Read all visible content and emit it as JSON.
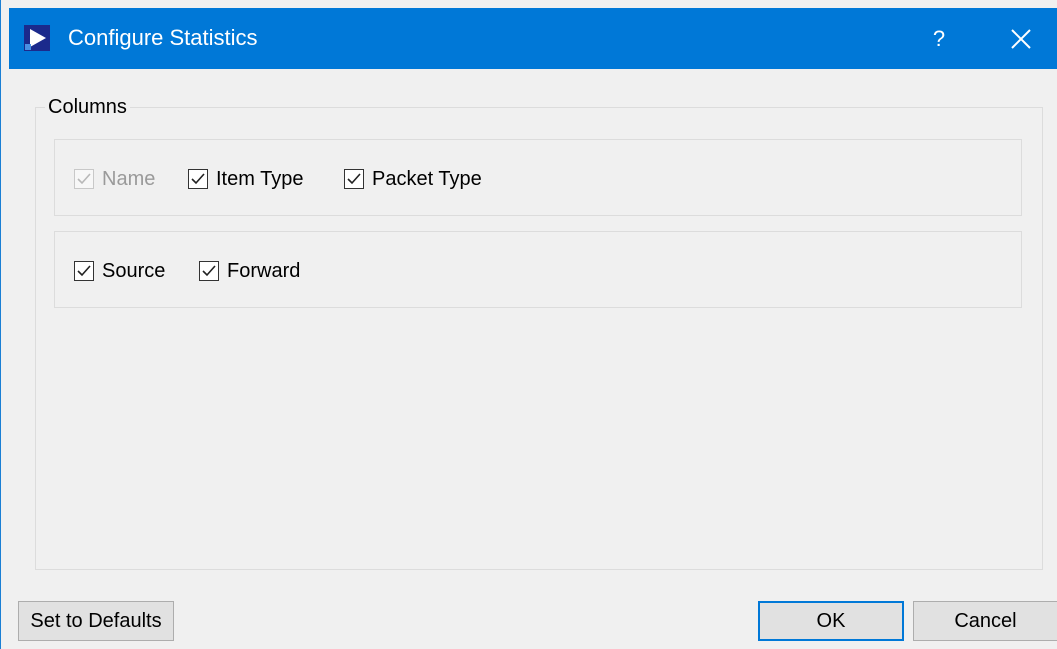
{
  "window": {
    "title": "Configure Statistics",
    "help_label": "?",
    "icons": {
      "app": "app-play-icon",
      "close": "close-icon"
    },
    "accent_color": "#0078d7"
  },
  "group": {
    "title": "Columns",
    "row1": [
      {
        "label": "Name",
        "checked": true,
        "disabled": true
      },
      {
        "label": "Item Type",
        "checked": true,
        "disabled": false
      },
      {
        "label": "Packet Type",
        "checked": true,
        "disabled": false
      }
    ],
    "row2": [
      {
        "label": "Source",
        "checked": true,
        "disabled": false
      },
      {
        "label": "Forward",
        "checked": true,
        "disabled": false
      }
    ]
  },
  "buttons": {
    "defaults": "Set to Defaults",
    "ok": "OK",
    "cancel": "Cancel"
  }
}
